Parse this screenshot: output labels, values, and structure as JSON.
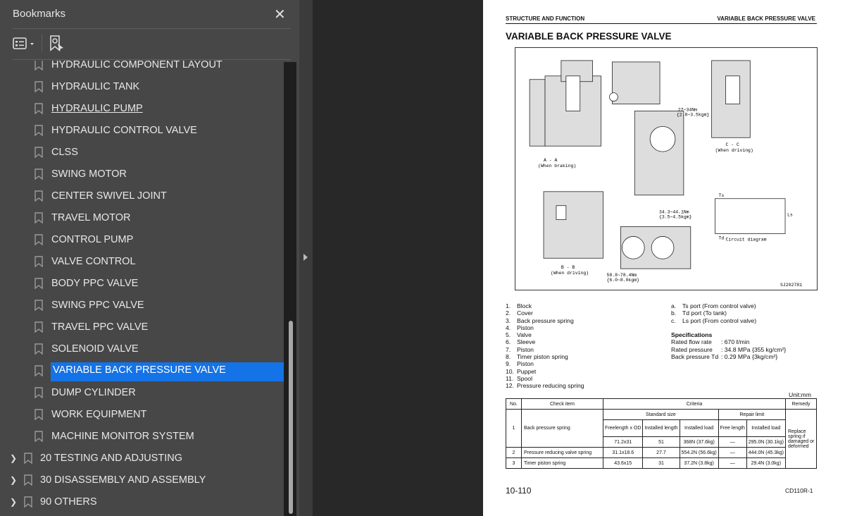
{
  "sidebar": {
    "title": "Bookmarks",
    "close": "✕",
    "items": [
      {
        "label": "HYDRAULIC COMPONENT LAYOUT",
        "level": 2
      },
      {
        "label": "HYDRAULIC TANK",
        "level": 2
      },
      {
        "label": "HYDRAULIC PUMP",
        "level": 2,
        "hover": true
      },
      {
        "label": "HYDRAULIC CONTROL VALVE",
        "level": 2
      },
      {
        "label": "CLSS",
        "level": 2
      },
      {
        "label": "SWING MOTOR",
        "level": 2
      },
      {
        "label": "CENTER SWIVEL JOINT",
        "level": 2
      },
      {
        "label": "TRAVEL MOTOR",
        "level": 2
      },
      {
        "label": "CONTROL PUMP",
        "level": 2
      },
      {
        "label": "VALVE CONTROL",
        "level": 2
      },
      {
        "label": "BODY PPC VALVE",
        "level": 2
      },
      {
        "label": "SWING PPC VALVE",
        "level": 2
      },
      {
        "label": "TRAVEL PPC VALVE",
        "level": 2
      },
      {
        "label": "SOLENOID VALVE",
        "level": 2
      },
      {
        "label": "VARIABLE BACK PRESSURE VALVE",
        "level": 2,
        "selected": true
      },
      {
        "label": "DUMP CYLINDER",
        "level": 2
      },
      {
        "label": "WORK EQUIPMENT",
        "level": 2
      },
      {
        "label": "MACHINE MONITOR SYSTEM",
        "level": 2
      },
      {
        "label": "20 TESTING AND ADJUSTING",
        "level": 1
      },
      {
        "label": "30 DISASSEMBLY AND ASSEMBLY",
        "level": 1
      },
      {
        "label": "90 OTHERS",
        "level": 1
      }
    ]
  },
  "colors": {
    "selected": "#1473e6",
    "panel": "#474747",
    "viewer": "#282828"
  },
  "page": {
    "header_left": "STRUCTURE AND FUNCTION",
    "header_right": "VARIABLE BACK PRESSURE VALVE",
    "title": "VARIABLE BACK PRESSURE VALVE",
    "figure": {
      "view_aa": "A - A",
      "view_aa_sub": "(When braking)",
      "view_bb": "B - B",
      "view_bb_sub": "(When driving)",
      "view_cc": "C - C",
      "view_cc_sub": "(When driving)",
      "circuit": "Circuit diagram",
      "torque1": "27~34Nm",
      "torque1b": "{2.8~3.5kgm}",
      "torque2": "34.3~44.1Nm",
      "torque2b": "{3.5~4.5kgm}",
      "torque3": "58.8~78.4Nm",
      "torque3b": "{6.0~8.0kgm}",
      "code": "SJ202781",
      "ts": "Ts",
      "td": "Td",
      "ls": "Ls"
    },
    "parts": [
      {
        "n": "1.",
        "t": "Block"
      },
      {
        "n": "2.",
        "t": "Cover"
      },
      {
        "n": "3.",
        "t": "Back pressure spring"
      },
      {
        "n": "4.",
        "t": "Piston"
      },
      {
        "n": "5.",
        "t": "Valve"
      },
      {
        "n": "6.",
        "t": "Sleeve"
      },
      {
        "n": "7.",
        "t": "Piston"
      },
      {
        "n": "8.",
        "t": "Timer piston spring"
      },
      {
        "n": "9.",
        "t": "Piston"
      },
      {
        "n": "10.",
        "t": "Puppet"
      },
      {
        "n": "11.",
        "t": "Spool"
      },
      {
        "n": "12.",
        "t": "Pressure reducing spring"
      }
    ],
    "ports": [
      {
        "n": "a.",
        "t": "Ts port (From control valve)"
      },
      {
        "n": "b.",
        "t": "Td port (To tank)"
      },
      {
        "n": "c.",
        "t": "Ls port (From control valve)"
      }
    ],
    "specs": {
      "title": "Specifications",
      "rows": [
        {
          "k": "Rated flow rate",
          "v": ": 670 ℓ/min"
        },
        {
          "k": "Rated pressure",
          "v": ": 34.8 MPa {355 kg/cm²}"
        },
        {
          "k": "Back pressure Td",
          "v": ": 0.29 MPa {3kg/cm²}"
        }
      ]
    },
    "unit": "Unit:mm",
    "table": {
      "h_no": "No.",
      "h_item": "Check item",
      "h_criteria": "Criteria",
      "h_remedy": "Remedy",
      "h_std": "Standard size",
      "h_rep": "Repair limit",
      "h_fl": "Freelength x OD",
      "h_il": "Installed length",
      "h_load": "Installed load",
      "h_free": "Free length",
      "h_rload": "Installed load",
      "rows": [
        {
          "no": "1",
          "item": "Back pressure spring",
          "fl": "71.2x31",
          "il": "51",
          "load": "368N (37.6kg)",
          "free": "—",
          "rload": "295.0N (30.1kg)"
        },
        {
          "no": "2",
          "item": "Pressure reducing valve spring",
          "fl": "31.1x18.6",
          "il": "27.7",
          "load": "554.2N (56.6kg)",
          "free": "—",
          "rload": "444.0N (45.3kg)"
        },
        {
          "no": "3",
          "item": "Timer piston spring",
          "fl": "43.6x15",
          "il": "31",
          "load": "37.2N (3.8kg)",
          "free": "—",
          "rload": "29.4N (3.0kg)"
        }
      ],
      "remedy": "Replace spring if damaged or deformed"
    },
    "page_number": "10-110",
    "model": "CD110R-1"
  }
}
